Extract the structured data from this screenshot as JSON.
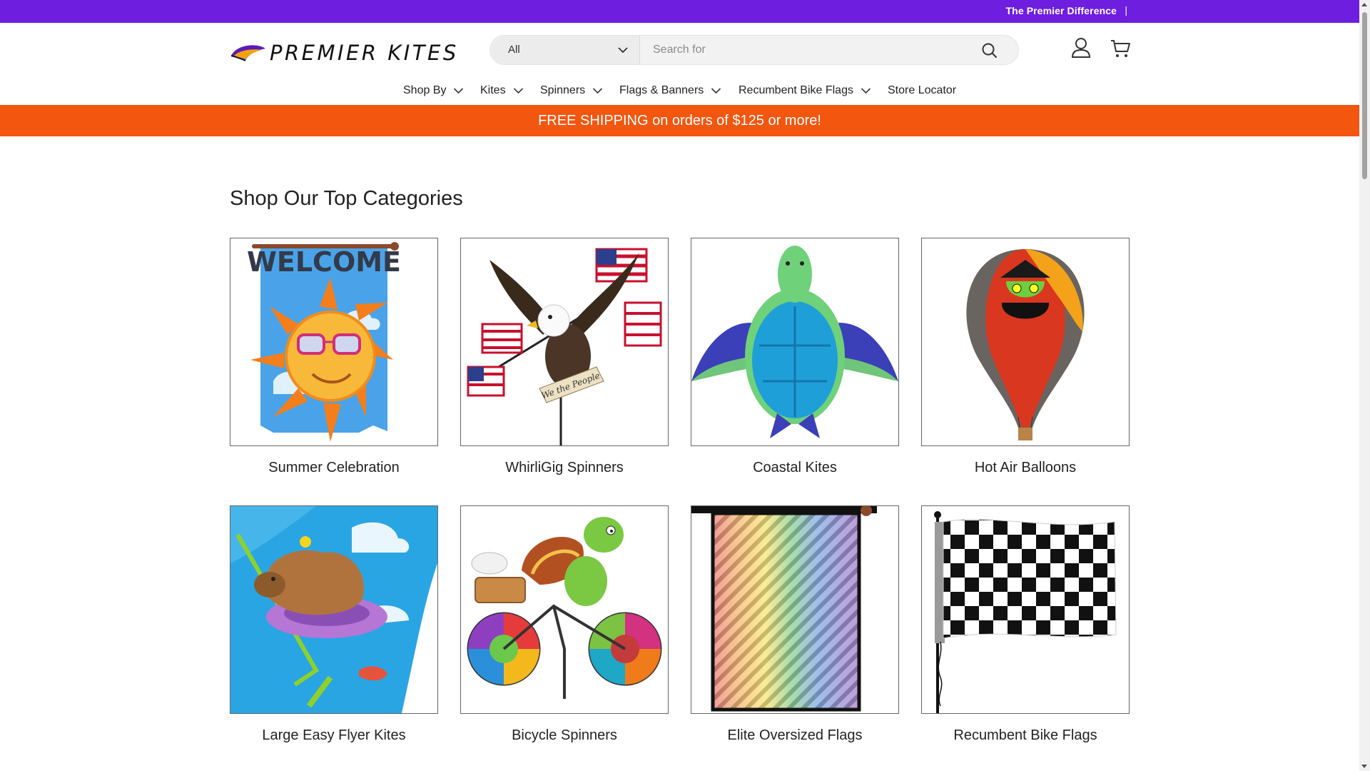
{
  "announcement": {
    "link": "The Premier Difference",
    "separator": "|"
  },
  "logo": {
    "text": "PREMIER KITES"
  },
  "search": {
    "category": "All",
    "placeholder": "Search for"
  },
  "icons": {
    "search": "search-icon",
    "account": "user-icon",
    "cart": "cart-icon"
  },
  "nav": {
    "items": [
      {
        "label": "Shop By",
        "has_dropdown": true
      },
      {
        "label": "Kites",
        "has_dropdown": true
      },
      {
        "label": "Spinners",
        "has_dropdown": true
      },
      {
        "label": "Flags & Banners",
        "has_dropdown": true
      },
      {
        "label": "Recumbent Bike Flags",
        "has_dropdown": true
      },
      {
        "label": "Store Locator",
        "has_dropdown": false
      }
    ]
  },
  "promo": {
    "text": "FREE SHIPPING on orders of $125 or more!"
  },
  "categories": {
    "title": "Shop Our Top Categories",
    "items": [
      {
        "label": "Summer Celebration",
        "image": "welcome-sun-banner",
        "image_text": "WELCOME"
      },
      {
        "label": "WhirliGig Spinners",
        "image": "eagle-whirligig",
        "image_text": "We the People"
      },
      {
        "label": "Coastal Kites",
        "image": "sea-turtle-kite"
      },
      {
        "label": "Hot Air Balloons",
        "image": "witch-hot-air-balloon"
      },
      {
        "label": "Large Easy Flyer Kites",
        "image": "capybara-kite"
      },
      {
        "label": "Bicycle Spinners",
        "image": "turtle-bicycle-spinner"
      },
      {
        "label": "Elite Oversized Flags",
        "image": "rainbow-lattice-flag"
      },
      {
        "label": "Recumbent Bike Flags",
        "image": "checkered-flag"
      }
    ]
  },
  "colors": {
    "announcement_bg": "#6d1ede",
    "promo_bg": "#f2560f",
    "text": "#222222",
    "search_bg": "#f2f2f2"
  }
}
